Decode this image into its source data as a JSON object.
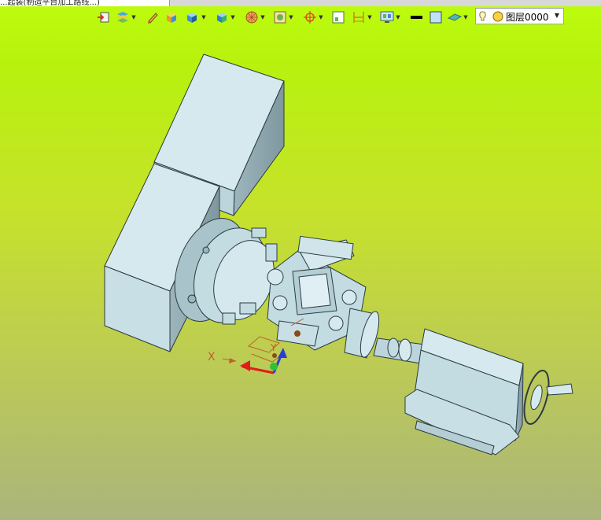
{
  "document_tab": {
    "title": "...起装(制造平台加工路线...)"
  },
  "toolbar": {
    "layer_label": "图层0000",
    "color_swatch": "#000000",
    "fill_swatch": "#bfe3f5",
    "tools": [
      {
        "name": "import-icon"
      },
      {
        "name": "layers-stack-icon"
      },
      {
        "name": "pen-icon"
      },
      {
        "name": "cube-orange-icon"
      },
      {
        "name": "cube-blue-icon"
      },
      {
        "name": "cube-face-icon"
      },
      {
        "name": "sphere-grid-icon"
      },
      {
        "name": "shaded-view-icon"
      },
      {
        "name": "target-icon"
      },
      {
        "name": "frame-icon"
      },
      {
        "name": "dimension-icon"
      },
      {
        "name": "display-icon"
      },
      {
        "name": "line-color-icon"
      },
      {
        "name": "fill-color-icon"
      },
      {
        "name": "plane-icon"
      }
    ]
  },
  "viewport": {
    "axis_x_label": "X",
    "axis_y_label": "Y",
    "background_top": "#bdfc0e",
    "background_bottom": "#abb47c",
    "model_color": "#c2dce2",
    "model_outline": "#2b3b42"
  }
}
